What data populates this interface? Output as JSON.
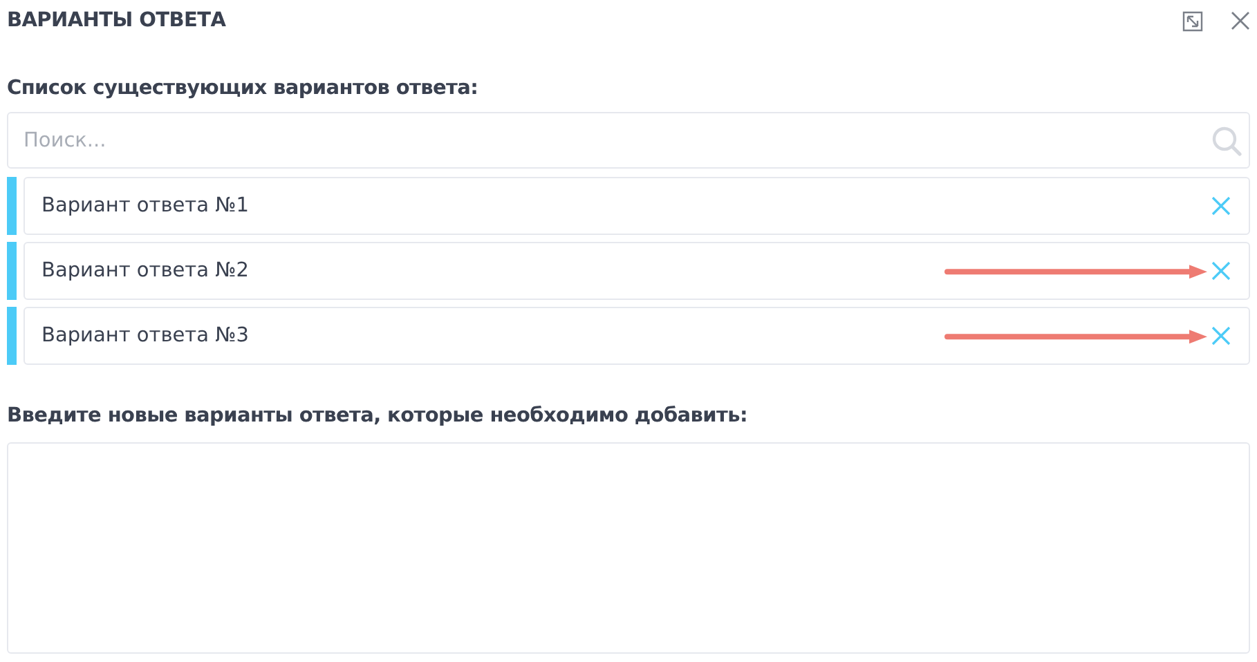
{
  "window": {
    "title": "ВАРИАНТЫ ОТВЕТА"
  },
  "existing": {
    "label": "Список существующих вариантов ответа:",
    "search": {
      "placeholder": "Поиск..."
    },
    "options": [
      {
        "text": "Вариант ответа №1",
        "annotated": false
      },
      {
        "text": "Вариант ответа №2",
        "annotated": true
      },
      {
        "text": "Вариант ответа №3",
        "annotated": true
      }
    ]
  },
  "new_options": {
    "label": "Введите новые варианты ответа, которые необходимо добавить:"
  }
}
